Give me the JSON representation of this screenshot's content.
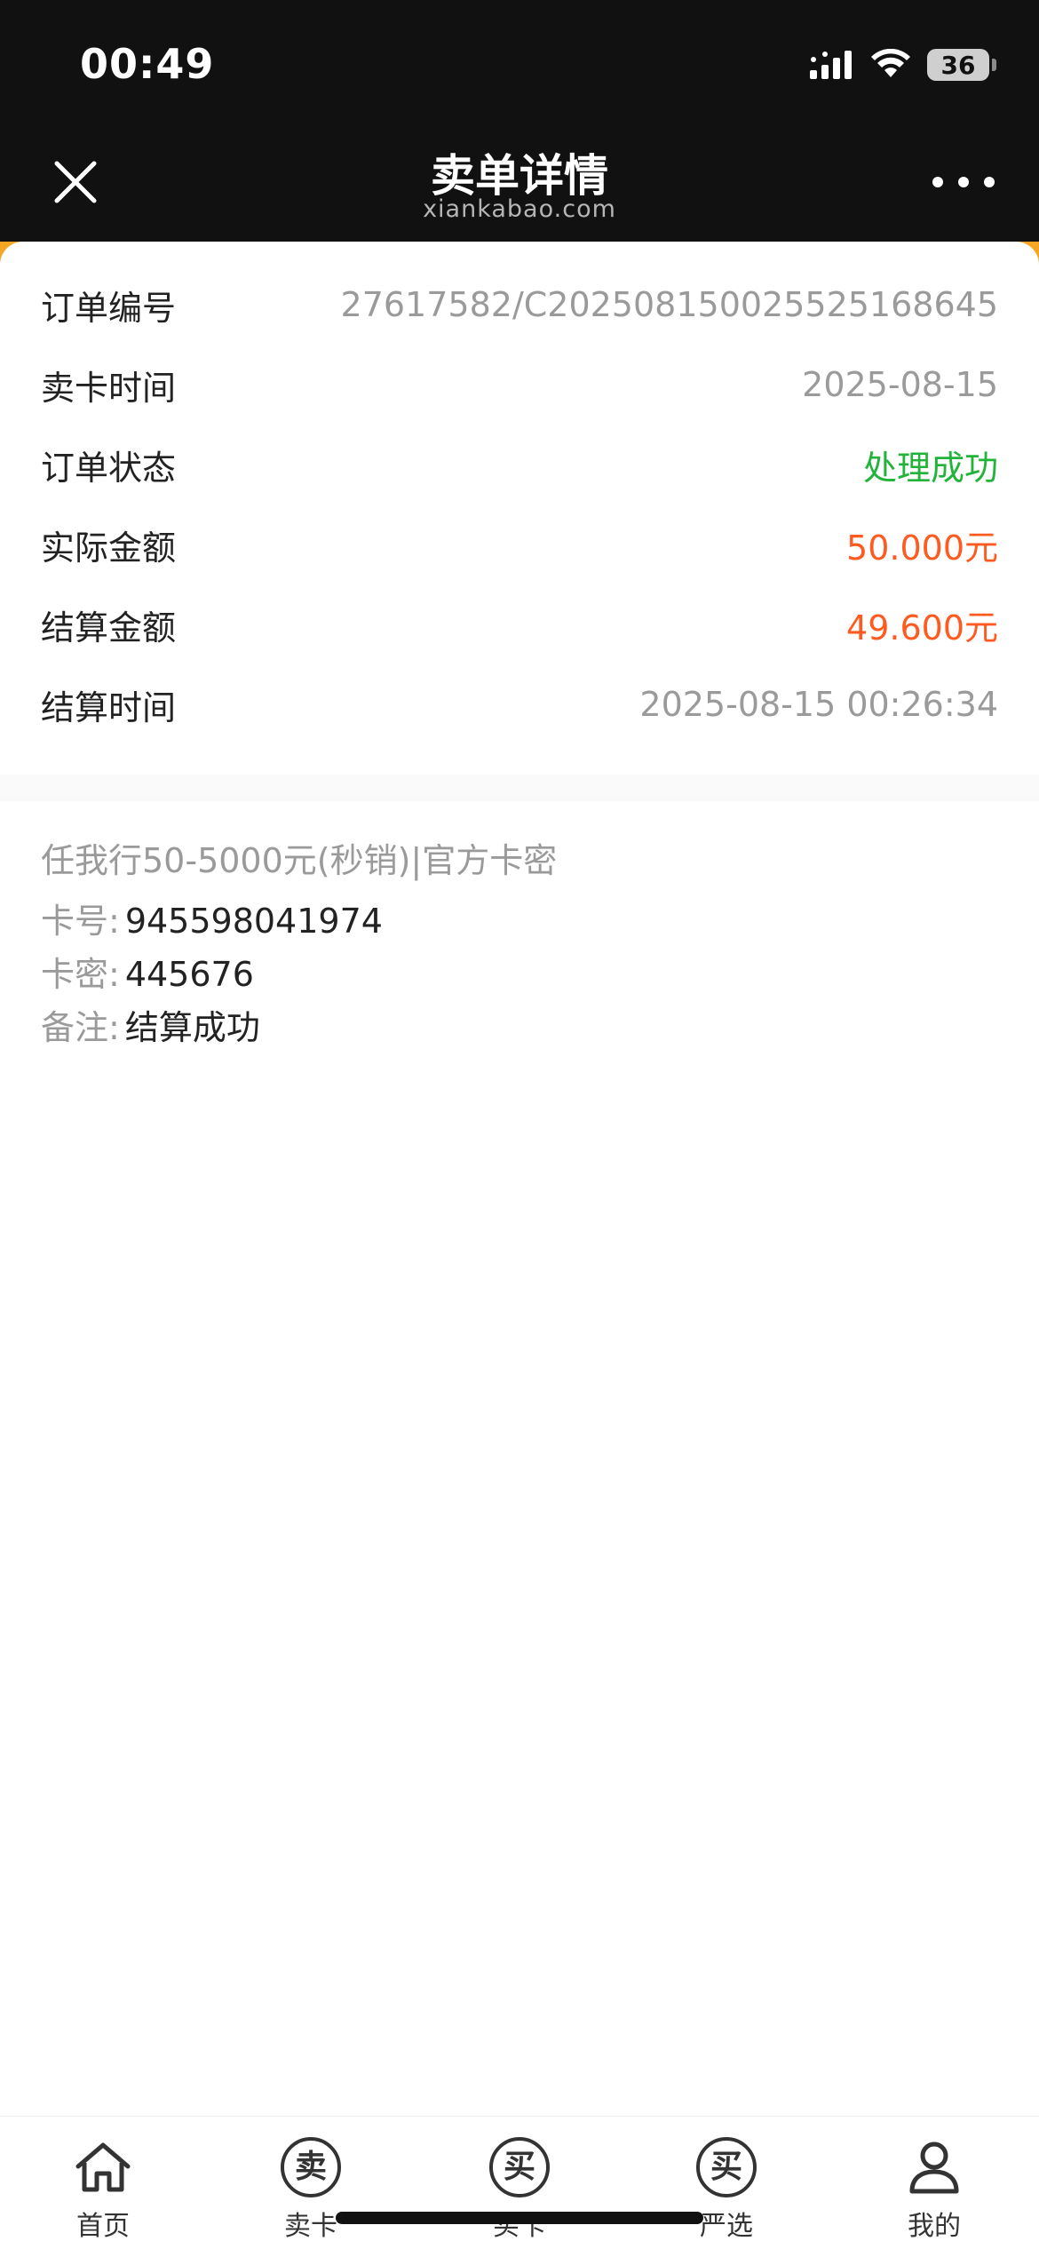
{
  "status_bar": {
    "time": "00:49",
    "battery": "36"
  },
  "nav": {
    "title": "卖单详情",
    "subtitle": "xiankabao.com"
  },
  "order": {
    "rows": [
      {
        "label": "订单编号",
        "value": "27617582/C20250815002552516​8645"
      },
      {
        "label": "卖卡时间",
        "value": "2025-08-15"
      },
      {
        "label": "订单状态",
        "value": "处理成功"
      },
      {
        "label": "实际金额",
        "value": "50.000元"
      },
      {
        "label": "结算金额",
        "value": "49.600元"
      },
      {
        "label": "结算时间",
        "value": "2025-08-15 00:26:34"
      }
    ]
  },
  "card": {
    "title": "任我行50-5000元(秒销)|官方卡密",
    "number_label": "卡号:",
    "number": "945598041974",
    "secret_label": "卡密:",
    "secret": "445676",
    "note_label": "备注:",
    "note": "结算成功"
  },
  "tabs": [
    {
      "label": "首页",
      "icon": "home-icon"
    },
    {
      "label": "卖卡",
      "icon": "sell-card-icon",
      "glyph": "卖"
    },
    {
      "label": "买卡",
      "icon": "buy-card-icon",
      "glyph": "买"
    },
    {
      "label": "严选",
      "icon": "selected-icon",
      "glyph": "买"
    },
    {
      "label": "我的",
      "icon": "user-icon"
    }
  ],
  "colors": {
    "success": "#22b33a",
    "amount": "#ff5a1f",
    "accent": "#f5a623"
  }
}
